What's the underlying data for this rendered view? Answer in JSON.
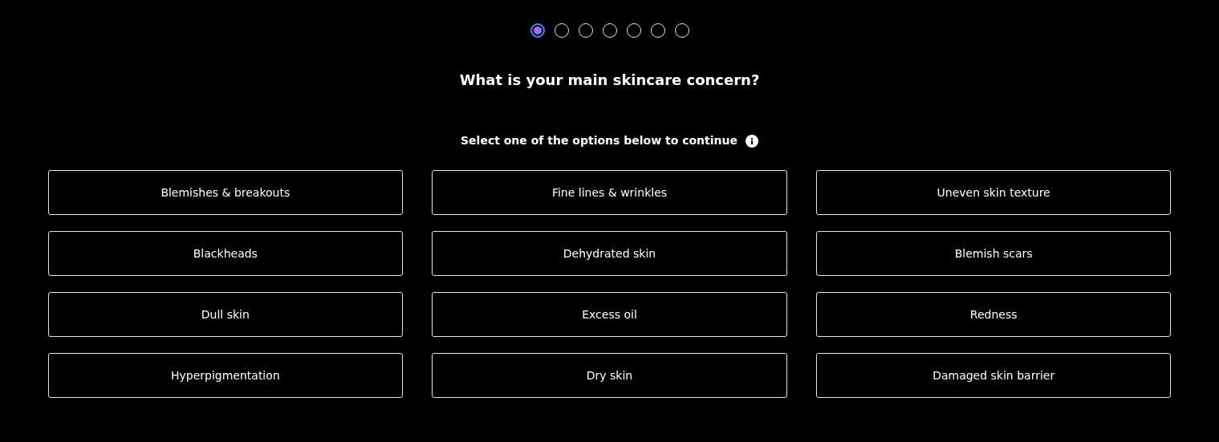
{
  "steps": [
    {
      "selected": true
    },
    {
      "selected": false
    },
    {
      "selected": false
    },
    {
      "selected": false
    },
    {
      "selected": false
    },
    {
      "selected": false
    },
    {
      "selected": false
    }
  ],
  "question": "What is your main skincare concern?",
  "instruction": "Select one of the options below to continue",
  "options": [
    {
      "label": "Blemishes & breakouts",
      "selected": false
    },
    {
      "label": "Fine lines & wrinkles",
      "selected": false
    },
    {
      "label": "Uneven skin texture",
      "selected": false
    },
    {
      "label": "Blackheads",
      "selected": false
    },
    {
      "label": "Dehydrated skin",
      "selected": false
    },
    {
      "label": "Blemish scars",
      "selected": false
    },
    {
      "label": "Dull skin",
      "selected": false
    },
    {
      "label": "Excess oil",
      "selected": false
    },
    {
      "label": "Redness",
      "selected": false
    },
    {
      "label": "Hyperpigmentation",
      "selected": false
    },
    {
      "label": "Dry skin",
      "selected": false
    },
    {
      "label": "Damaged skin barrier",
      "selected": false
    }
  ]
}
